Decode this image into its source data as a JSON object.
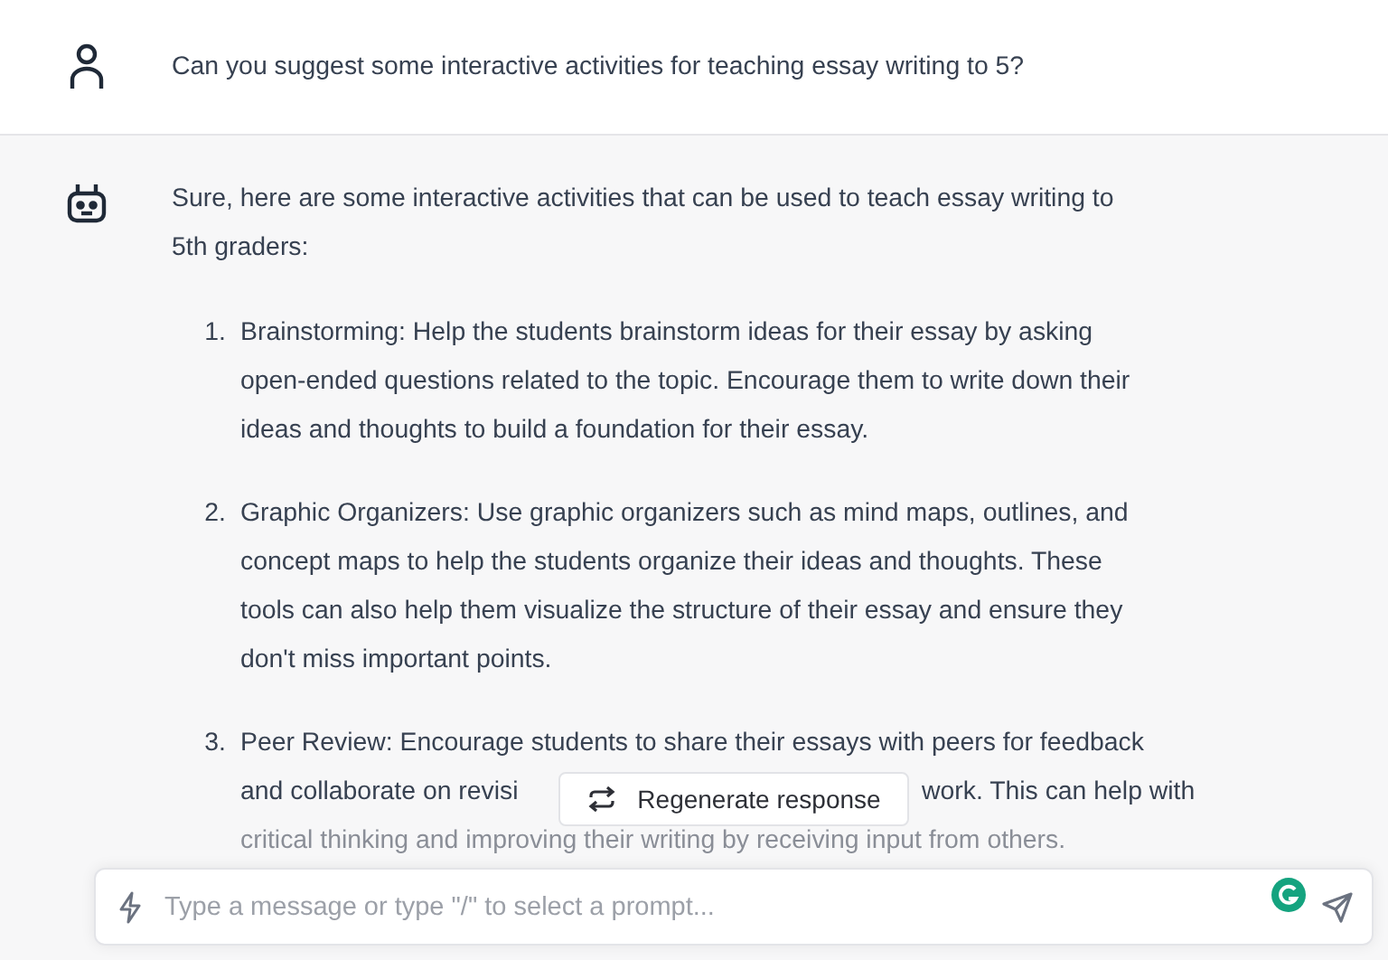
{
  "user_message": {
    "text": "Can you suggest some interactive activities for teaching essay writing to 5?"
  },
  "assistant_message": {
    "intro": [
      "Sure, here are some interactive activities that can be used to teach essay writing to",
      "5th graders:"
    ],
    "items": [
      {
        "number": "1.",
        "lines": [
          [
            "Brainstorming: Help the students brainstorm ideas for their essay by asking"
          ],
          [
            "open-ended questions related to the topic. Encourage them to write down their"
          ],
          [
            "ideas and thoughts to build a foundation for their essay."
          ]
        ]
      },
      {
        "number": "2.",
        "lines": [
          [
            "Graphic Organizers: Use graphic organizers such as mind maps, outlines, and"
          ],
          [
            "concept maps to help the students organize their ideas and thoughts. These"
          ],
          [
            "tools can also help them visualize the structure of their essay and ensure they"
          ],
          [
            "don't miss important points."
          ]
        ]
      },
      {
        "number": "3.",
        "lines": [
          [
            "Peer Review: Encourage students to share their essays with peers for feedback"
          ],
          [
            "and collaborate on revisi",
            "work. This can help with"
          ],
          [
            "critical thinking and improving their writing by receiving input from others."
          ]
        ]
      }
    ]
  },
  "regenerate_button": {
    "label": "Regenerate response"
  },
  "composer": {
    "placeholder": "Type a message or type \"/\" to select a prompt..."
  }
}
